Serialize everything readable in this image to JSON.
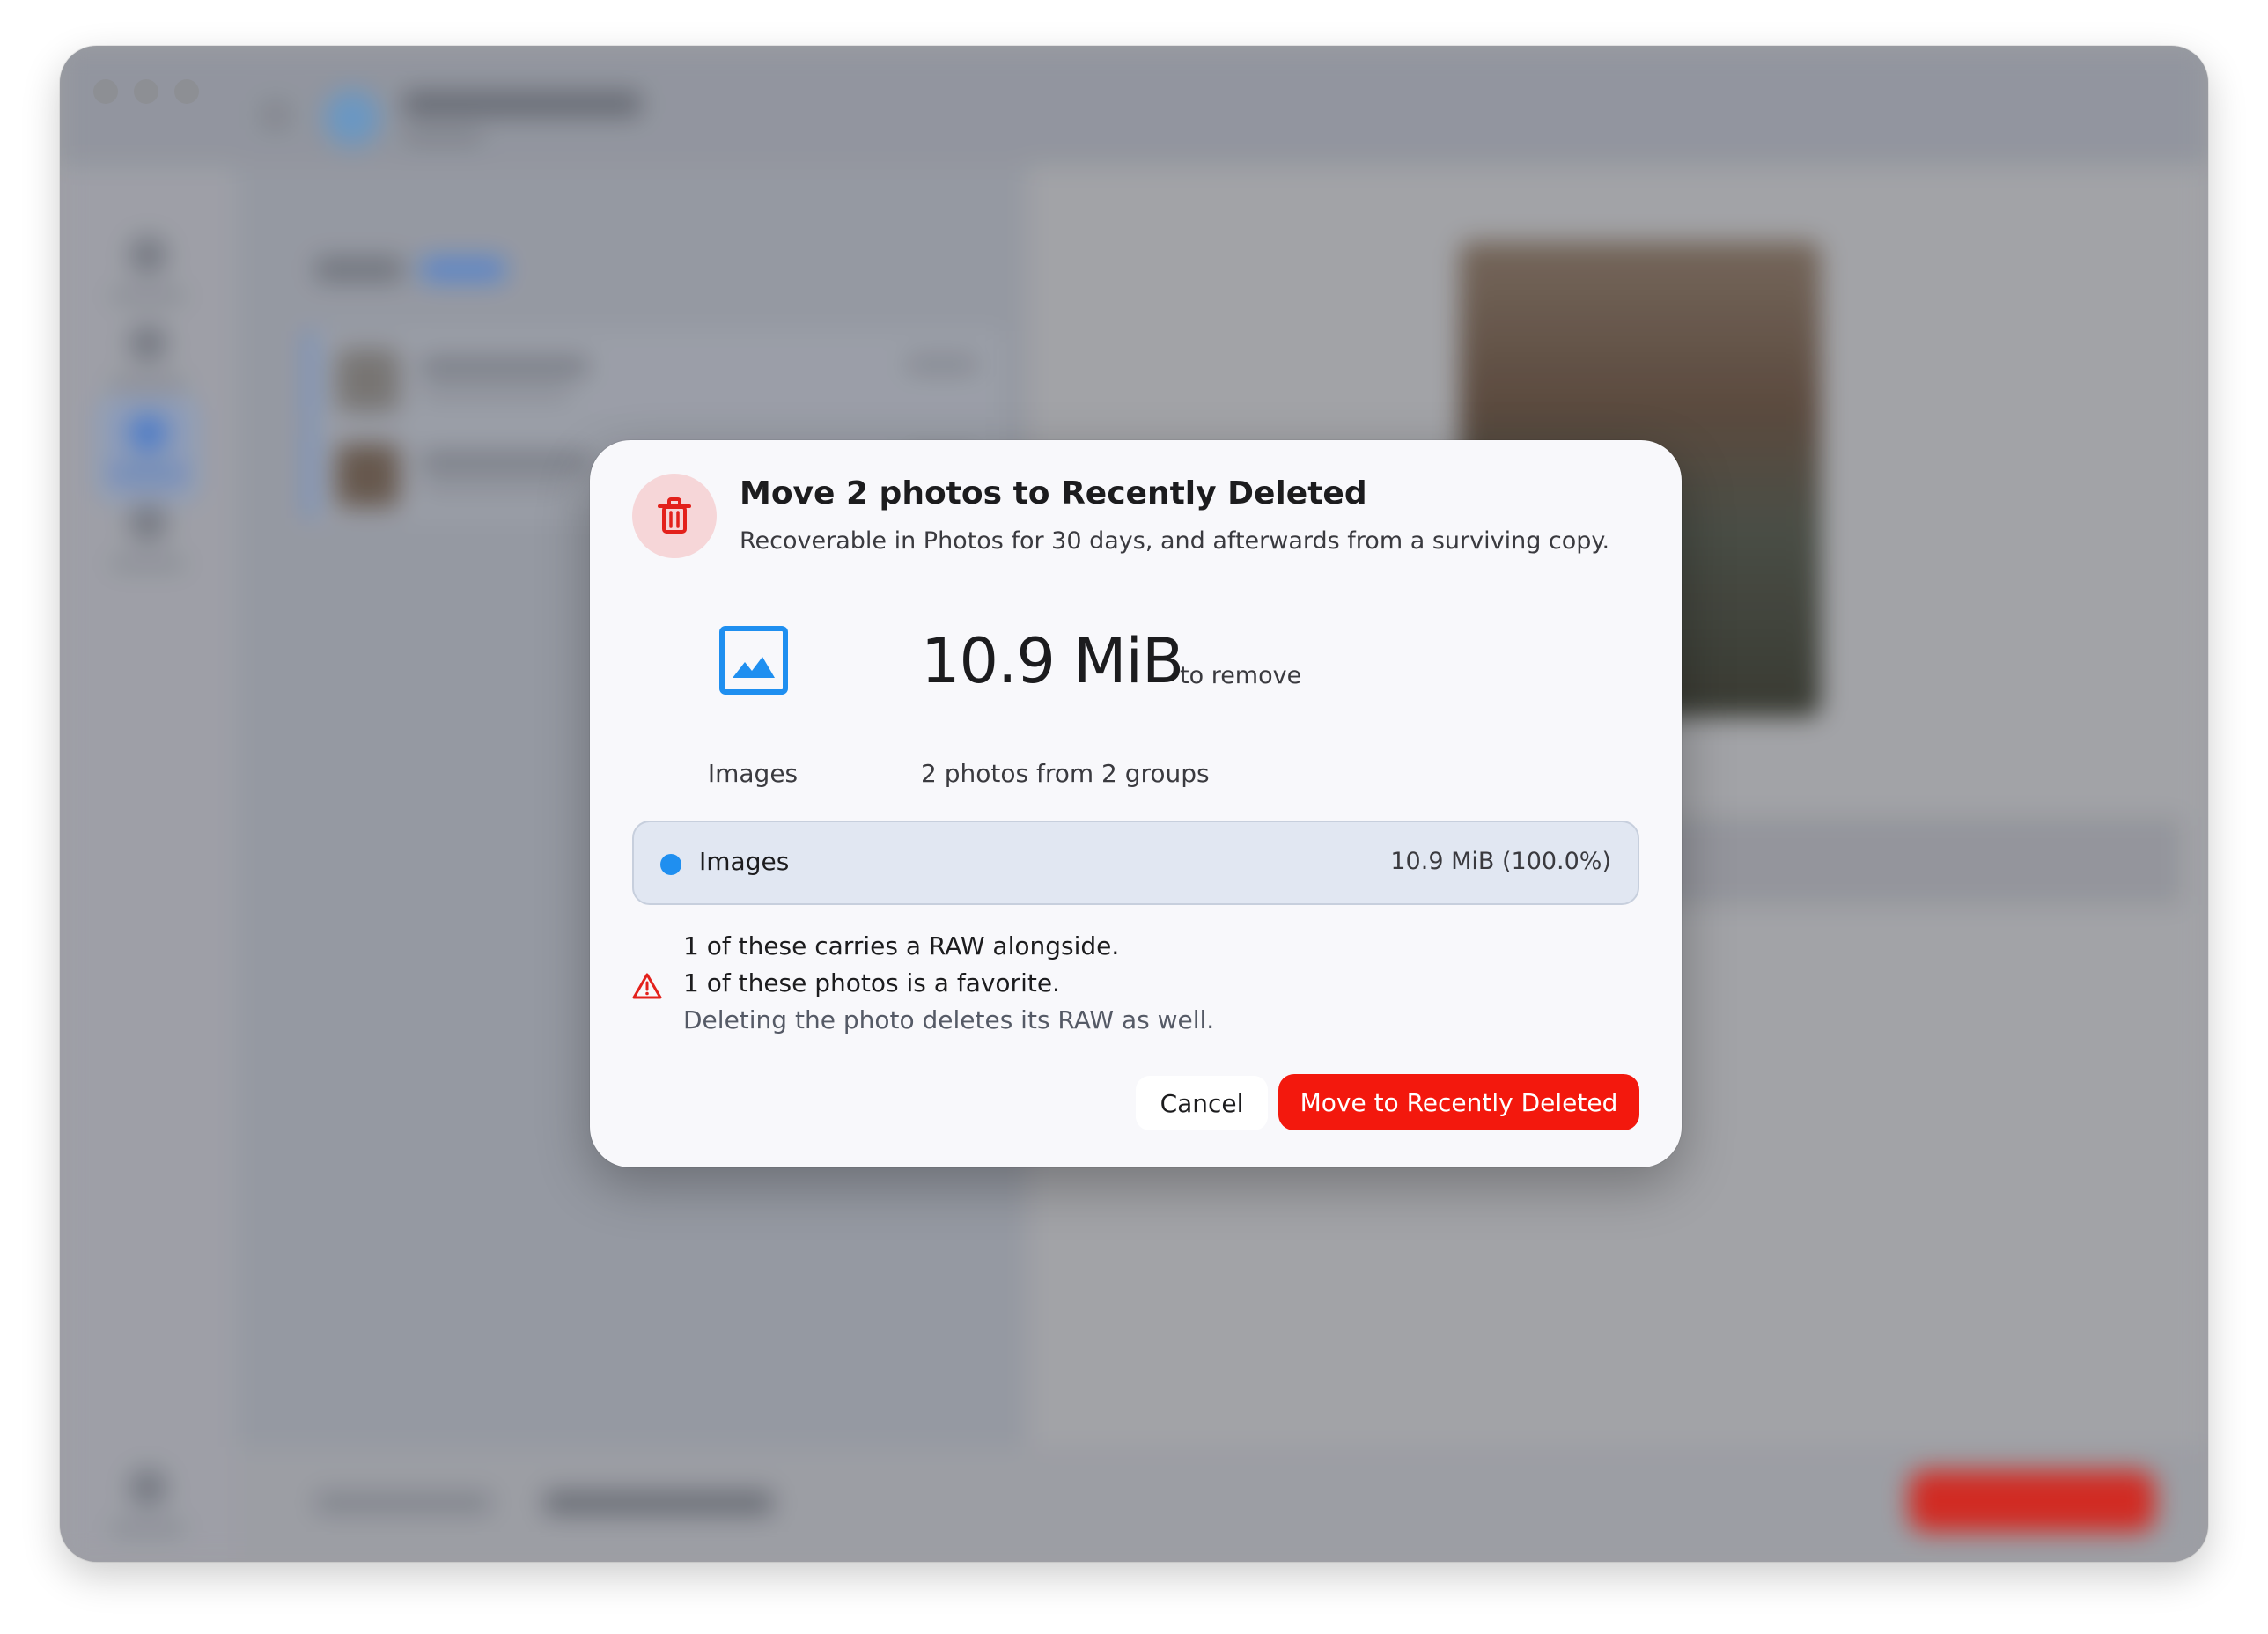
{
  "dialog": {
    "title": "Move 2 photos to Recently Deleted",
    "subtitle": "Recoverable in Photos for 30 days, and afterwards from a surviving copy.",
    "header_icon": "trash-icon",
    "category_icon": "image-icon",
    "size_value": "10.9 MiB",
    "size_suffix": "to remove",
    "category_label": "Images",
    "summary": "2 photos from 2 groups",
    "breakdown": [
      {
        "name": "Images",
        "size": "10.9 MiB (100.0%)",
        "color": "#1f8ff0"
      }
    ],
    "warning_icon": "warning-triangle-icon",
    "warnings": [
      "1 of these carries a RAW alongside.",
      "1 of these photos is a favorite.",
      "Deleting the photo deletes its RAW as well."
    ],
    "cancel_label": "Cancel",
    "confirm_label": "Move to Recently Deleted"
  },
  "colors": {
    "danger": "#f3180d",
    "danger_soft": "#f6d6d8",
    "accent_blue": "#1f8ff0",
    "breakdown_bg": "#e1e7f2",
    "dialog_bg": "#f8f8fb"
  }
}
